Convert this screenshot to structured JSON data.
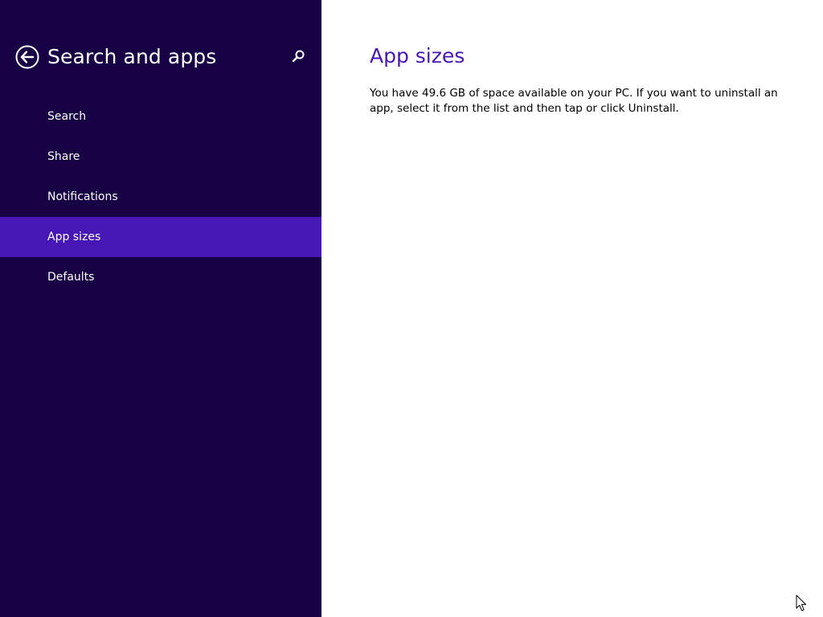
{
  "colors": {
    "sidebar_bg": "#180044",
    "selected_bg": "#4617b4",
    "accent": "#4617b4",
    "content_bg": "#ffffff"
  },
  "sidebar": {
    "title": "Search and apps",
    "back_icon": "back-arrow-circle-icon",
    "search_icon": "search-icon",
    "items": [
      {
        "label": "Search",
        "selected": false
      },
      {
        "label": "Share",
        "selected": false
      },
      {
        "label": "Notifications",
        "selected": false
      },
      {
        "label": "App sizes",
        "selected": true
      },
      {
        "label": "Defaults",
        "selected": false
      }
    ]
  },
  "main": {
    "title": "App sizes",
    "description": "You have 49.6 GB of space available on your PC. If you want to uninstall an app, select it from the list and then tap or click Uninstall."
  }
}
